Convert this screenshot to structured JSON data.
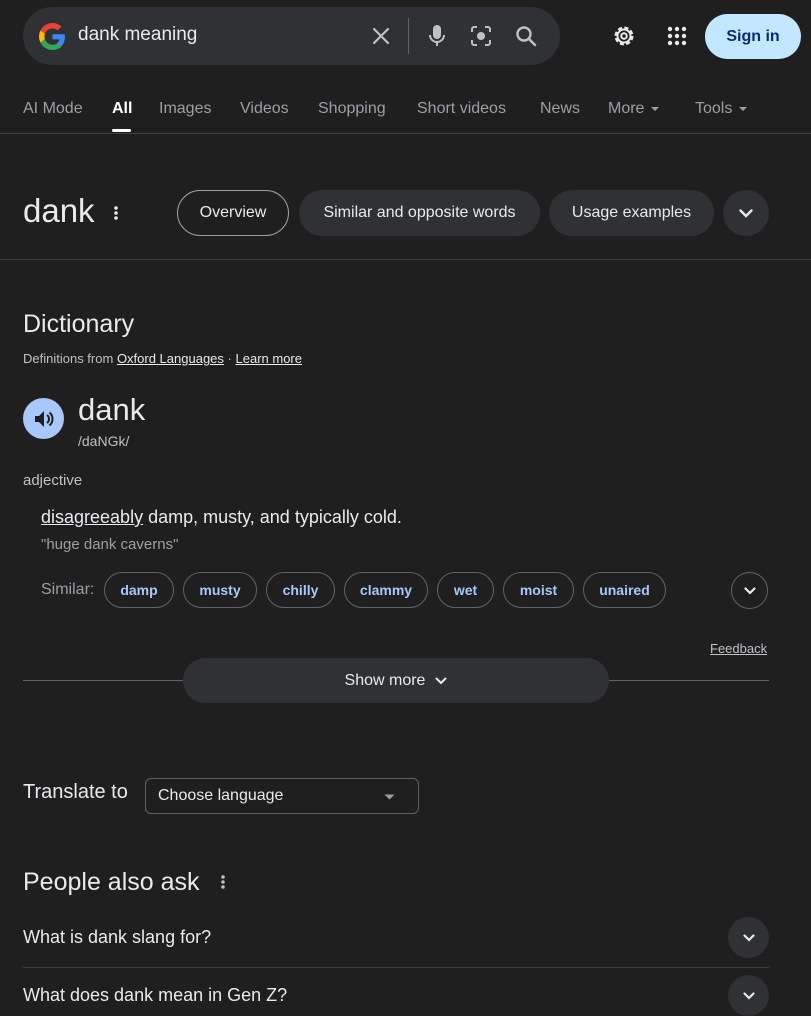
{
  "search": {
    "query": "dank meaning",
    "sign_in_label": "Sign in"
  },
  "tabs": [
    {
      "label": "AI Mode"
    },
    {
      "label": "All"
    },
    {
      "label": "Images"
    },
    {
      "label": "Videos"
    },
    {
      "label": "Shopping"
    },
    {
      "label": "Short videos"
    },
    {
      "label": "News"
    },
    {
      "label": "More"
    },
    {
      "label": "Tools"
    }
  ],
  "entity": {
    "title": "dank",
    "chips": [
      "Overview",
      "Similar and opposite words",
      "Usage examples"
    ]
  },
  "dictionary": {
    "heading": "Dictionary",
    "source_prefix": "Definitions from",
    "source_name": "Oxford Languages",
    "separator": "·",
    "learn_more": "Learn more",
    "word": "dank",
    "phonetic": "/daNGk/",
    "part_of_speech": "adjective",
    "definition_link": "disagreeably",
    "definition_rest": " damp, musty, and typically cold.",
    "example": "\"huge dank caverns\"",
    "similar_label": "Similar:",
    "similar_words": [
      "damp",
      "musty",
      "chilly",
      "clammy",
      "wet",
      "moist",
      "unaired"
    ],
    "feedback": "Feedback",
    "show_more": "Show more"
  },
  "translate": {
    "label": "Translate to",
    "select_value": "Choose language"
  },
  "people_also_ask": {
    "heading": "People also ask",
    "questions": [
      "What is dank slang for?",
      "What does dank mean in Gen Z?"
    ]
  },
  "colors": {
    "background": "#1f1f1f",
    "surface": "#303134",
    "accent": "#a8c7fa",
    "signin_bg": "#c2e7ff"
  }
}
